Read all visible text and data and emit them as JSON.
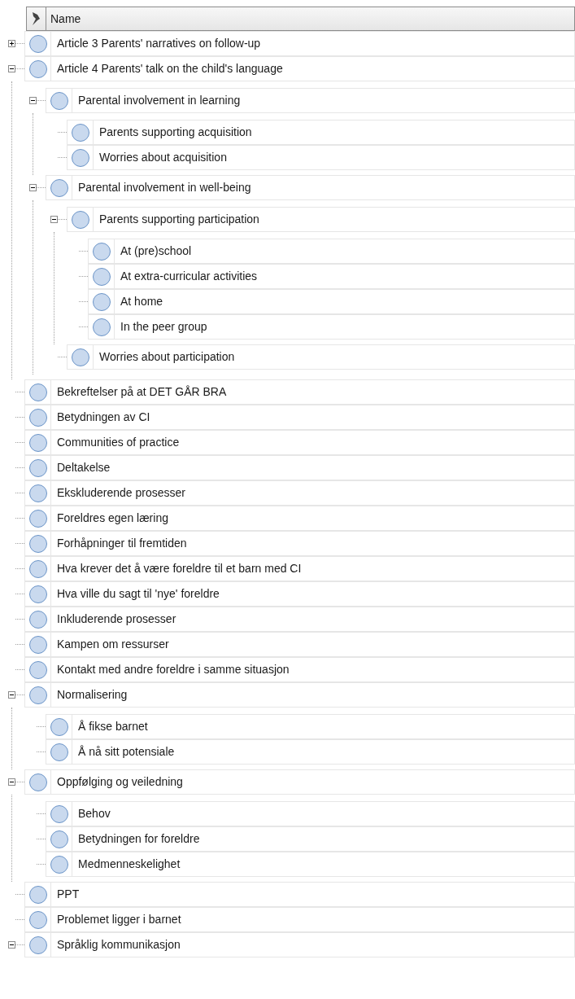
{
  "header": {
    "column": "Name"
  },
  "nodes": [
    {
      "label": "Article 3 Parents' narratives on follow-up",
      "expanded": false
    },
    {
      "label": "Article 4 Parents' talk on the child's language",
      "expanded": true,
      "children": [
        {
          "label": "Parental involvement in learning",
          "expanded": true,
          "children": [
            {
              "label": "Parents supporting acquisition"
            },
            {
              "label": "Worries about acquisition"
            }
          ]
        },
        {
          "label": "Parental involvement in well-being",
          "expanded": true,
          "children": [
            {
              "label": "Parents supporting participation",
              "expanded": true,
              "children": [
                {
                  "label": "At (pre)school"
                },
                {
                  "label": "At extra-curricular activities"
                },
                {
                  "label": "At home"
                },
                {
                  "label": "In the peer group"
                }
              ]
            },
            {
              "label": "Worries about participation"
            }
          ]
        }
      ]
    },
    {
      "label": "Bekreftelser på at DET GÅR BRA"
    },
    {
      "label": "Betydningen av CI"
    },
    {
      "label": "Communities of practice"
    },
    {
      "label": "Deltakelse"
    },
    {
      "label": "Ekskluderende prosesser"
    },
    {
      "label": "Foreldres egen læring"
    },
    {
      "label": "Forhåpninger til fremtiden"
    },
    {
      "label": "Hva krever det å være foreldre til et barn med CI"
    },
    {
      "label": "Hva ville du sagt til 'nye' foreldre"
    },
    {
      "label": "Inkluderende prosesser"
    },
    {
      "label": "Kampen om ressurser"
    },
    {
      "label": "Kontakt med andre foreldre i samme situasjon"
    },
    {
      "label": "Normalisering",
      "expanded": true,
      "children": [
        {
          "label": "Å fikse barnet"
        },
        {
          "label": "Å nå sitt potensiale"
        }
      ]
    },
    {
      "label": "Oppfølging og veiledning",
      "expanded": true,
      "children": [
        {
          "label": "Behov"
        },
        {
          "label": "Betydningen for foreldre"
        },
        {
          "label": "Medmenneskelighet"
        }
      ]
    },
    {
      "label": "PPT"
    },
    {
      "label": "Problemet ligger i barnet"
    },
    {
      "label": "Språklig kommunikasjon",
      "expanded": true
    }
  ]
}
